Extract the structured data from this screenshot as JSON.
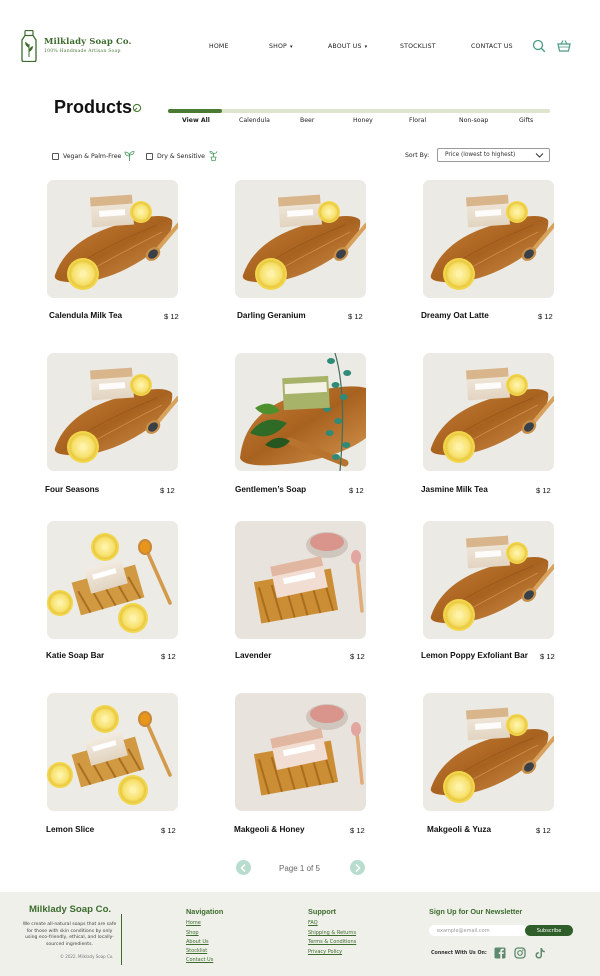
{
  "brand": {
    "name": "Milklady Soap Co.",
    "tagline": "100% Handmade Artisan Soap"
  },
  "nav": {
    "home": "HOME",
    "shop": "SHOP",
    "about": "ABOUT US",
    "stocklist": "STOCKLIST",
    "contact": "CONTACT US"
  },
  "page": {
    "title": "Products"
  },
  "tabs": [
    "View All",
    "Calendula",
    "Beer",
    "Honey",
    "Floral",
    "Non-soap",
    "Gifts"
  ],
  "filters": {
    "vegan": "Vegan & Palm-Free",
    "dry": "Dry & Sensitive"
  },
  "sort": {
    "label": "Sort By:",
    "value": "Price (lowest to highest)"
  },
  "products": [
    {
      "name": "Calendula Milk Tea",
      "price": "$ 12",
      "image": "lemon-poppy"
    },
    {
      "name": "Darling Geranium",
      "price": "$ 12",
      "image": "lemon-poppy"
    },
    {
      "name": "Dreamy Oat Latte",
      "price": "$ 12",
      "image": "lemon-poppy"
    },
    {
      "name": "Four Seasons",
      "price": "$ 12",
      "image": "lemon-poppy"
    },
    {
      "name": "Gentlemen’s Soap",
      "price": "$ 12",
      "image": "eucalyptus"
    },
    {
      "name": "Jasmine Milk Tea",
      "price": "$ 12",
      "image": "lemon-poppy"
    },
    {
      "name": "Katie Soap Bar",
      "price": "$ 12",
      "image": "turmeric-lemon"
    },
    {
      "name": "Lavender",
      "price": "$ 12",
      "image": "pink-salt"
    },
    {
      "name": "Lemon Poppy Exfoliant Bar",
      "price": "$ 12",
      "image": "lemon-poppy"
    },
    {
      "name": "Lemon Slice",
      "price": "$ 12",
      "image": "turmeric-lemon"
    },
    {
      "name": "Makgeoli & Honey",
      "price": "$ 12",
      "image": "pink-salt"
    },
    {
      "name": "Makgeoli & Yuza",
      "price": "$ 12",
      "image": "lemon-poppy"
    }
  ],
  "pagination": {
    "text": "Page 1 of 5"
  },
  "footer": {
    "brand": "Milklady Soap Co.",
    "description": "We create all-natural soaps that are safe for those with skin conditions by only using eco-friendly, ethical, and locally-sourced ingredients.",
    "copyright": "© 2022, Milklady Soap Co.",
    "nav_heading": "Navigation",
    "nav_links": [
      "Home",
      "Shop",
      "About Us",
      "Stocklist",
      "Contact Us"
    ],
    "support_heading": "Support",
    "support_links": [
      "FAQ",
      "Shipping & Returns",
      "Terms & Conditions",
      "Privacy Policy"
    ],
    "newsletter_heading": "Sign Up for Our Newsletter",
    "email_placeholder": "example@email.com",
    "subscribe": "Subscribe",
    "connect": "Connect With Us On:"
  },
  "colors": {
    "brand_green": "#3d6b2e",
    "accent_mint": "#b8dccd",
    "footer_bg": "#eef0e9"
  },
  "icons": [
    "search-icon",
    "cart-icon",
    "leaf-icon",
    "chevron-down-icon",
    "chevron-left-icon",
    "chevron-right-icon",
    "facebook-icon",
    "instagram-icon",
    "tiktok-icon"
  ]
}
